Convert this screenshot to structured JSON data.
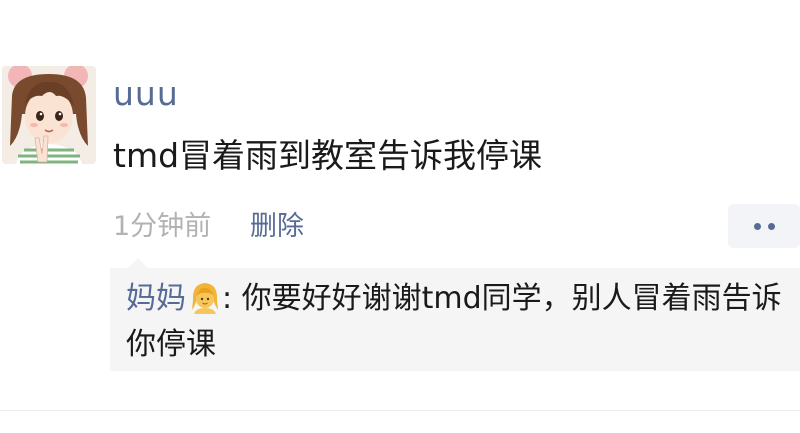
{
  "post": {
    "username": "uuu",
    "text": "tmd冒着雨到教室告诉我停课",
    "timestamp": "1分钟前",
    "delete_label": "删除",
    "avatar_icon": "cartoon-girl-avatar"
  },
  "comments": [
    {
      "author": "妈妈",
      "emoji_icon": "woman-emoji",
      "separator": ": ",
      "text": "你要好好谢谢tmd同学，别人冒着雨告诉你停课"
    }
  ],
  "colors": {
    "link": "#576b95",
    "text": "#1a1a1a",
    "meta": "#b2b2b2",
    "comment_bg": "#f5f5f6"
  }
}
